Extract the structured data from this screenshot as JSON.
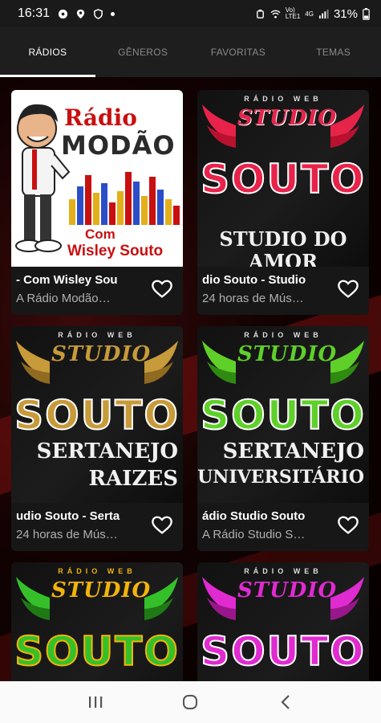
{
  "status": {
    "time": "16:31",
    "battery": "31%"
  },
  "tabs": [
    {
      "label": "RÁDIOS",
      "active": true
    },
    {
      "label": "GÊNEROS",
      "active": false
    },
    {
      "label": "FAVORITAS",
      "active": false
    },
    {
      "label": "TEMAS",
      "active": false
    }
  ],
  "cards": [
    {
      "title": "- Com Wisley Sou",
      "subtitle": "A Rádio Modão…",
      "art": {
        "radio": "Rádio",
        "main": "MODÃO",
        "com": "Com",
        "name": "Wisley Souto"
      }
    },
    {
      "title": "dio Souto - Studio",
      "subtitle": "24 horas de Mús…",
      "art": {
        "top": "RÁDIO WEB",
        "studio": "STUDIO",
        "souto": "SOUTO",
        "extra": "STUDIO DO AMOR",
        "accent": "#e8234a"
      }
    },
    {
      "title": "udio Souto - Serta",
      "subtitle": "24 horas de Mús…",
      "art": {
        "top": "RÁDIO WEB",
        "studio": "STUDIO",
        "souto": "SOUTO",
        "extra1": "SERTANEJO",
        "extra2": "RAIZES",
        "accent": "#c79a3a"
      }
    },
    {
      "title": "ádio Studio Souto",
      "subtitle": "A Rádio Studio S…",
      "art": {
        "top": "RÁDIO WEB",
        "studio": "STUDIO",
        "souto": "SOUTO",
        "extra1": "SERTANEJO",
        "extra2": "UNIVERSITÁRIO",
        "accent": "#5fcf2a"
      }
    },
    {
      "art": {
        "top": "RÁDIO WEB",
        "studio": "STUDIO",
        "souto": "SOUTO",
        "accent": "#f2b40c",
        "accent2": "#35c02a"
      }
    },
    {
      "art": {
        "top": "RÁDIO WEB",
        "studio": "STUDIO",
        "souto": "SOUTO",
        "accent": "#e02bd0"
      }
    }
  ],
  "icons": {
    "heart": "heart-outline-icon",
    "nav_recent": "recent-apps-icon",
    "nav_home": "home-icon",
    "nav_back": "back-icon"
  }
}
